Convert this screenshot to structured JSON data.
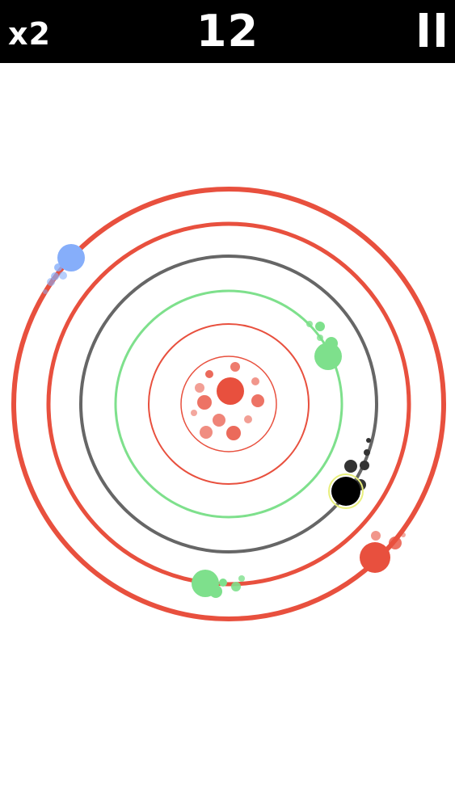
{
  "hud": {
    "multiplier": "x2",
    "score": "12"
  },
  "icons": {
    "pause": "pause-icon"
  },
  "colors": {
    "red": "#e8503e",
    "green": "#7ee08c",
    "gray": "#666666",
    "blue": "#86aefa",
    "black": "#000000",
    "highlight": "#e8ef7c"
  }
}
